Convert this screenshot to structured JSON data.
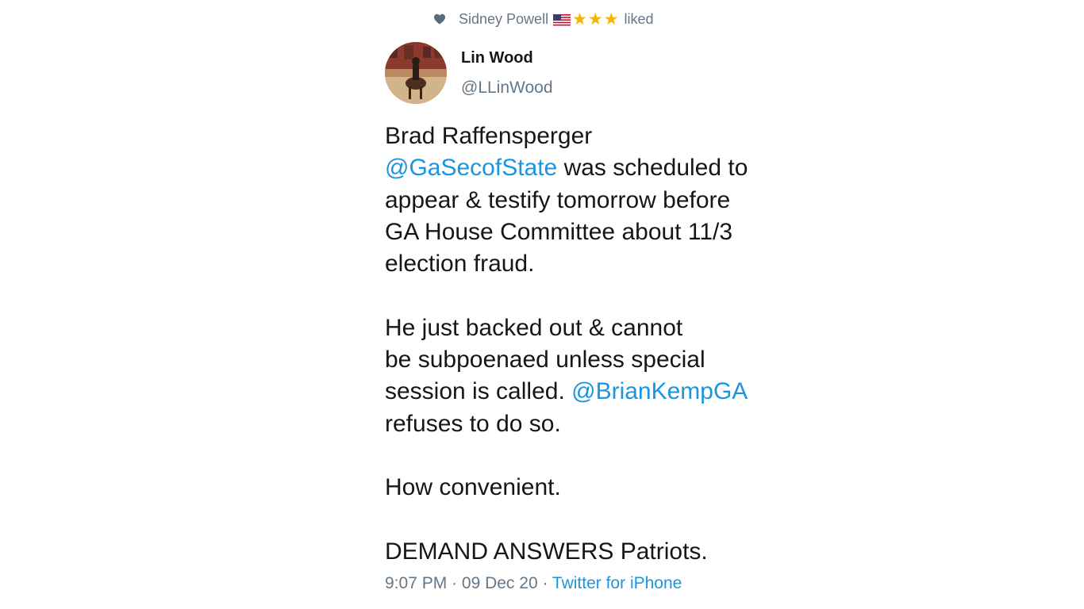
{
  "social_context": {
    "user": "Sidney Powell",
    "action": "liked",
    "flag": "🇺🇸",
    "stars": "⭐⭐⭐",
    "icon": "heart-icon"
  },
  "author": {
    "name": "Lin Wood",
    "handle": "@LLinWood",
    "avatar": "avatar-horse-rider"
  },
  "tweet": {
    "p1": {
      "line1": "Brad Raffensperger",
      "mention": "@GaSecofState",
      "after_mention": " was scheduled to",
      "line3": "appear & testify tomorrow before",
      "line4": "GA House Committee about 11/3",
      "line5": "election fraud."
    },
    "p2": {
      "line1": "He just backed out & cannot",
      "line2": "be subpoenaed unless special",
      "before_mention": "session is called. ",
      "mention": "@BrianKempGA",
      "line4": "refuses to do so."
    },
    "p3": "How convenient.",
    "p4": "DEMAND ANSWERS Patriots."
  },
  "meta": {
    "time": "9:07 PM",
    "separator": " · ",
    "date": "09 Dec 20",
    "source": "Twitter for iPhone"
  },
  "colors": {
    "link": "#1b95e0",
    "secondary_text": "#657786",
    "primary_text": "#14171a",
    "star": "#f5b400"
  }
}
